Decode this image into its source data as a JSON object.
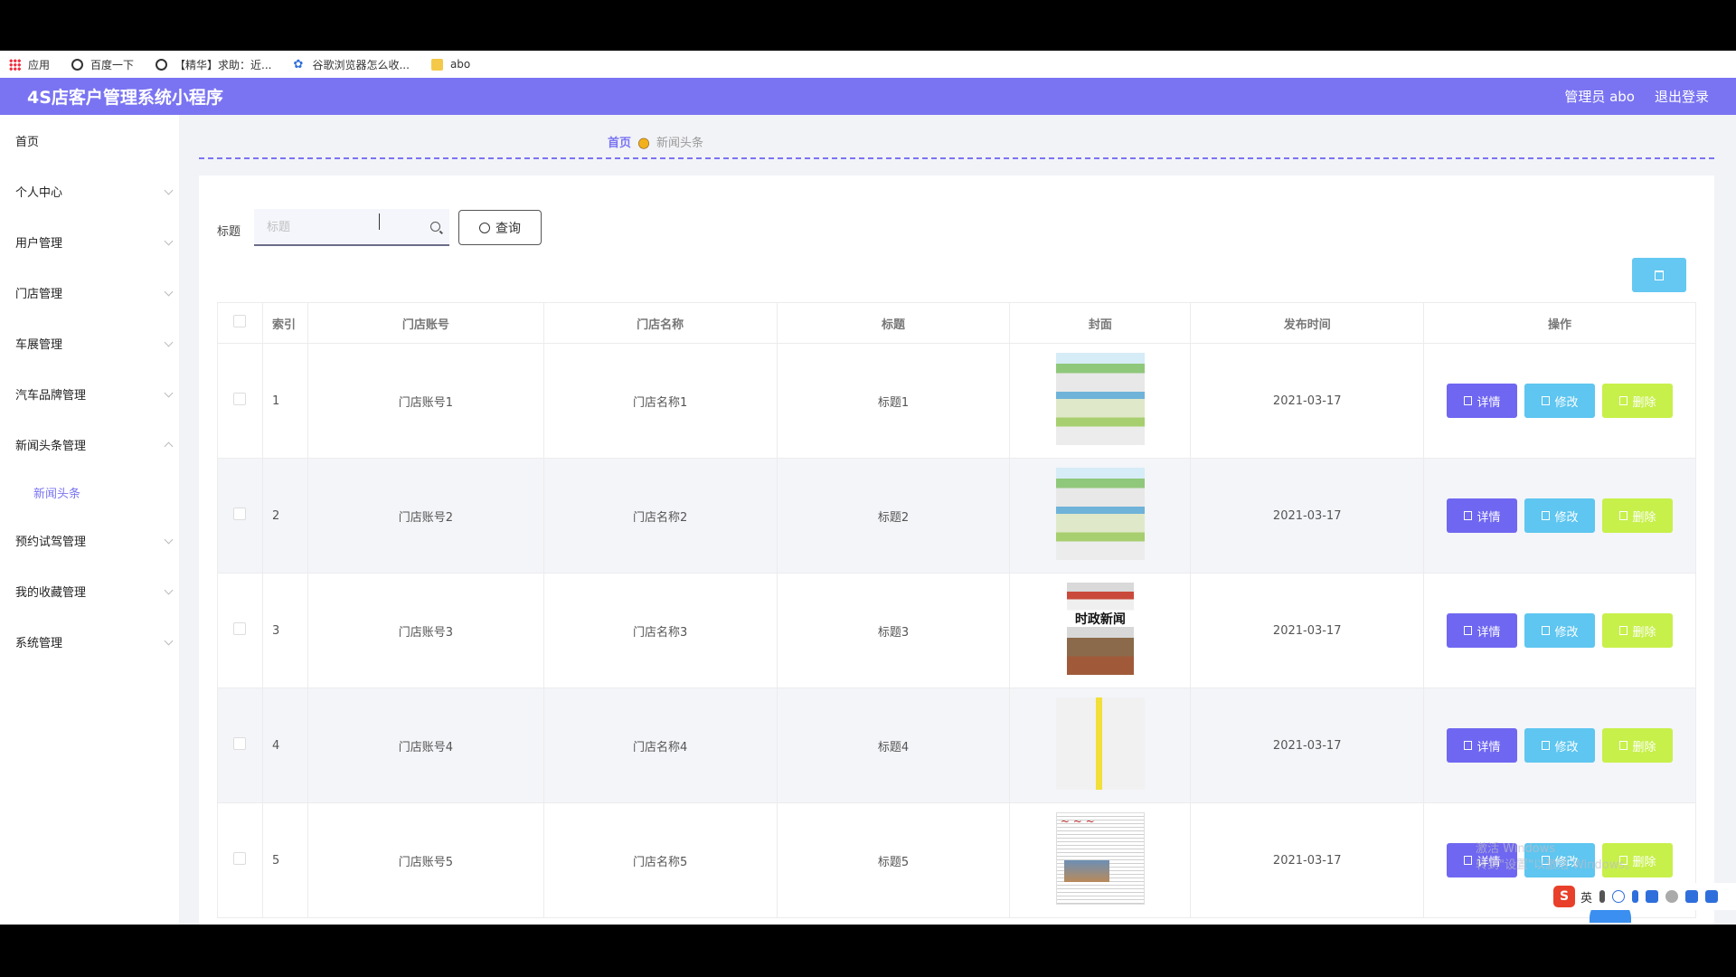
{
  "bookmarks": [
    {
      "label": "应用",
      "icon": "apps-grid-icon"
    },
    {
      "label": "百度一下",
      "icon": "globe-icon"
    },
    {
      "label": "【精华】求助：近...",
      "icon": "globe-icon"
    },
    {
      "label": "谷歌浏览器怎么收...",
      "icon": "paw-icon"
    },
    {
      "label": "abo",
      "icon": "folder-icon"
    }
  ],
  "header": {
    "title": "4S店客户管理系统小程序",
    "admin": "管理员 abo",
    "logout": "退出登录",
    "color": "#7a74f2"
  },
  "sidebar": {
    "items": [
      {
        "label": "首页"
      },
      {
        "label": "个人中心"
      },
      {
        "label": "用户管理"
      },
      {
        "label": "门店管理"
      },
      {
        "label": "车展管理"
      },
      {
        "label": "汽车品牌管理"
      },
      {
        "label": "新闻头条管理"
      },
      {
        "label": "预约试驾管理"
      },
      {
        "label": "我的收藏管理"
      },
      {
        "label": "系统管理"
      }
    ],
    "sub_item": "新闻头条"
  },
  "breadcrumb": {
    "home": "首页",
    "current": "新闻头条"
  },
  "search": {
    "label": "标题",
    "placeholder": "标题",
    "button": "查询"
  },
  "table": {
    "headers": [
      "索引",
      "门店账号",
      "门店名称",
      "标题",
      "封面",
      "发布时间",
      "操作"
    ],
    "rows": [
      {
        "index": "1",
        "account": "门店账号1",
        "name": "门店名称1",
        "title": "标题1",
        "cover": "newspaper-cover-green",
        "date": "2021-03-17"
      },
      {
        "index": "2",
        "account": "门店账号2",
        "name": "门店名称2",
        "title": "标题2",
        "cover": "newspaper-cover-green",
        "date": "2021-03-17"
      },
      {
        "index": "3",
        "account": "门店账号3",
        "name": "门店名称3",
        "title": "标题3",
        "cover": "newspaper-cover-politics",
        "date": "2021-03-17"
      },
      {
        "index": "4",
        "account": "门店账号4",
        "name": "门店名称4",
        "title": "标题4",
        "cover": "newspaper-cover-yellow",
        "date": "2021-03-17"
      },
      {
        "index": "5",
        "account": "门店账号5",
        "name": "门店名称5",
        "title": "标题5",
        "cover": "newspaper-cover-daily",
        "date": "2021-03-17"
      }
    ],
    "cover3_text": "时政新闻",
    "actions": {
      "detail": "详情",
      "edit": "修改",
      "delete": "删除"
    }
  },
  "system": {
    "watermark_line1": "激活 Windows",
    "watermark_line2": "转到\"设置\"以激活 Windows。",
    "ime_lang": "英"
  }
}
